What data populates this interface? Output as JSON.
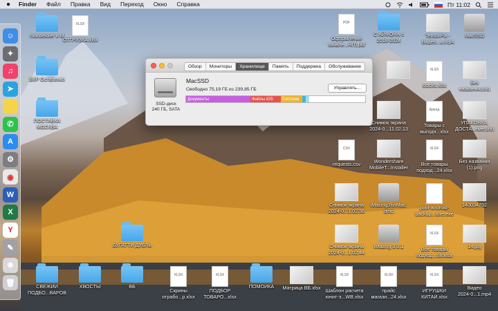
{
  "menubar": {
    "app": "Finder",
    "items": [
      "Файл",
      "Правка",
      "Вид",
      "Переход",
      "Окно",
      "Справка"
    ],
    "clock": "Пт 11:02"
  },
  "window": {
    "tabs": [
      "Обзор",
      "Мониторы",
      "Хранилище",
      "Память",
      "Поддержка",
      "Обслуживание"
    ],
    "active_tab": "Хранилище",
    "drive_name": "MacSSD",
    "free_text": "Свободно 75,19 ГБ из 239,85 ГБ",
    "manage_button": "Управлять...",
    "disk_type": "SSD-диск",
    "disk_size": "240 ГБ, SATA",
    "segments": [
      {
        "label": "Документы",
        "fraction": 0.36,
        "color": "#c85fe0"
      },
      {
        "label": "Файлы iOS",
        "fraction": 0.17,
        "color": "#e8514b"
      },
      {
        "label": "Система",
        "fraction": 0.12,
        "color": "#f2b424"
      },
      {
        "label": "",
        "fraction": 0.02,
        "color": "#39b5e6"
      },
      {
        "label": "",
        "fraction": 0.02,
        "color": "#a6dce8"
      }
    ]
  },
  "desktop_left": [
    {
      "label": "manbekker и М",
      "kind": "folder"
    },
    {
      "label": "ОТГРУЗКА.xlsx",
      "kind": "doc",
      "tag": "XLSX"
    },
    {
      "label": "ВКР Остапенко",
      "kind": "folder"
    },
    {
      "label": "ПОСТАВКА",
      "label2": "МОСКВА",
      "kind": "folder"
    },
    {
      "label": "БУГАТТИ ДУБЛЬ",
      "kind": "folder"
    }
  ],
  "desktop_right": [
    {
      "label": "Оформление",
      "label2": "заявле...НП).pdf",
      "kind": "doc",
      "tag": "PDF"
    },
    {
      "label": "С АЙФОНА с",
      "label2": "2018-2024",
      "kind": "folder"
    },
    {
      "label": "TensorPix -",
      "label2": "Видео...ь.mp4",
      "kind": "thumb"
    },
    {
      "label": "MacSSD",
      "kind": "drive"
    },
    {
      "label": "",
      "kind": "thumb"
    },
    {
      "label": "stocks.xlsx",
      "kind": "doc",
      "tag": "XLSX"
    },
    {
      "label": "Без",
      "label2": "названия.png",
      "kind": "thumb"
    },
    {
      "label": "Снимок экрана",
      "label2": "2024-0...11.02.13",
      "kind": "thumb"
    },
    {
      "label": "Товары с",
      "label2": "выгодн...xlsx",
      "kind": "doc",
      "tag": "Бренд"
    },
    {
      "label": "УПАКОВКА,",
      "label2": "ДОСТА...ние.png",
      "kind": "thumb"
    },
    {
      "label": "requests.csv",
      "kind": "doc",
      "tag": "CSV"
    },
    {
      "label": "Wondershare",
      "label2": "MobileT...Installer",
      "kind": "thumb"
    },
    {
      "label": "Все товары",
      "label2": "подход...24.xlsx",
      "kind": "doc",
      "tag": "XLSX"
    },
    {
      "label": "Без названия",
      "label2": "(1).png",
      "kind": "thumb"
    },
    {
      "label": "Снимок экрана",
      "label2": "2024-0...1.02.36",
      "kind": "thumb"
    },
    {
      "label": "iMazing3forMac.",
      "label2": "dmg",
      "kind": "drive"
    },
    {
      "label": "pool-android-",
      "label2": "backup...tore.exe",
      "kind": "doc",
      "tag": ""
    },
    {
      "label": "140034792",
      "kind": "thumb"
    },
    {
      "label": "Снимок экрана",
      "label2": "2024-0...1.02.44",
      "kind": "thumb"
    },
    {
      "label": "iMazing 3.0.1",
      "kind": "drive"
    },
    {
      "label": "Все товары",
      "label2": "подход...08.xlsx",
      "kind": "doc",
      "tag": "XLSX"
    },
    {
      "label": "14.jpg",
      "kind": "thumb"
    }
  ],
  "desktop_bottom": [
    {
      "label": "СВЕЖИЙ",
      "label2": "ПОДБО...ВАРОВ",
      "kind": "folder"
    },
    {
      "label": "ХВОСТЫ",
      "kind": "folder"
    },
    {
      "label": "ВБ",
      "kind": "folder"
    },
    {
      "label": "Скрины",
      "label2": "отрабо...р.xlsx",
      "kind": "doc",
      "tag": "XLSX"
    },
    {
      "label": "ПОДБОР",
      "label2": "ТОВАРО...xlsx",
      "kind": "doc",
      "tag": "XLSX"
    },
    {
      "label": "ПОМОЙКА",
      "kind": "folder"
    },
    {
      "label": "Матрица ВБ.xlsx",
      "kind": "thumb"
    },
    {
      "label": "Шаблон расчета",
      "label2": "юнит-э...WB.xlsx",
      "kind": "doc",
      "tag": "XLSX"
    },
    {
      "label": "прайс",
      "label2": "магази...24.xlsx",
      "kind": "doc",
      "tag": "XLSX"
    },
    {
      "label": "ИГРУШКИ",
      "label2": "КИТАЙ.xlsx",
      "kind": "doc",
      "tag": "XLSX"
    },
    {
      "label": "Видео",
      "label2": "2024-0...1.mp4",
      "kind": "thumb"
    }
  ],
  "dock": [
    {
      "icon": "finder-icon",
      "color": "#3e8ee8"
    },
    {
      "icon": "launchpad-icon",
      "color": "#6c6c72"
    },
    {
      "icon": "music-icon",
      "color": "#f0426a"
    },
    {
      "icon": "telegram-icon",
      "color": "#2aa3e0"
    },
    {
      "icon": "notes-icon",
      "color": "#f5d44a"
    },
    {
      "icon": "whatsapp-icon",
      "color": "#2ec24c"
    },
    {
      "icon": "app-store-icon",
      "color": "#2a8cf0"
    },
    {
      "icon": "system-preferences-icon",
      "color": "#7d7d82"
    },
    {
      "icon": "chrome-icon",
      "color": "#e8e8e8"
    },
    {
      "icon": "word-icon",
      "color": "#2b5fb8"
    },
    {
      "icon": "excel-icon",
      "color": "#1f7a45"
    },
    {
      "icon": "yandex-icon",
      "color": "#ffffff"
    },
    {
      "icon": "preview-icon",
      "color": "#a0a0a5"
    },
    {
      "icon": "photos-icon",
      "color": "#d9d9d9"
    },
    {
      "icon": "trash-icon",
      "color": "#cfcfd4"
    }
  ]
}
